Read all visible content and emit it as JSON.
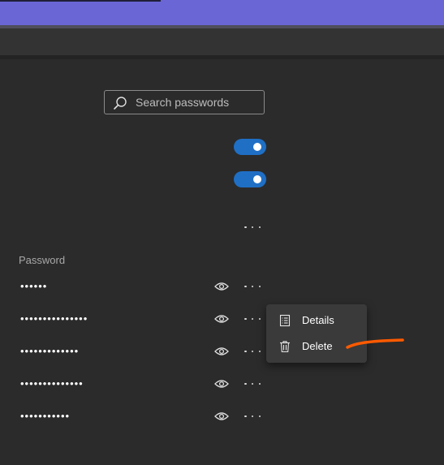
{
  "search": {
    "placeholder": "Search passwords",
    "icon": "search-icon"
  },
  "toggles": [
    {
      "state": "on"
    },
    {
      "state": "on"
    }
  ],
  "list": {
    "column_header": "Password",
    "rows": [
      {
        "password": "••••••"
      },
      {
        "password": "•••••••••••••••"
      },
      {
        "password": "•••••••••••••"
      },
      {
        "password": "••••••••••••••"
      },
      {
        "password": "•••••••••••"
      }
    ]
  },
  "context_menu": {
    "items": [
      {
        "label": "Details",
        "icon": "details-list-icon"
      },
      {
        "label": "Delete",
        "icon": "trash-icon"
      }
    ]
  },
  "colors": {
    "accent_top_bar": "#6b66d6",
    "toggle_on": "#1f6fc5",
    "annotation_stroke": "#ff5a00",
    "background": "#2b2b2b"
  }
}
